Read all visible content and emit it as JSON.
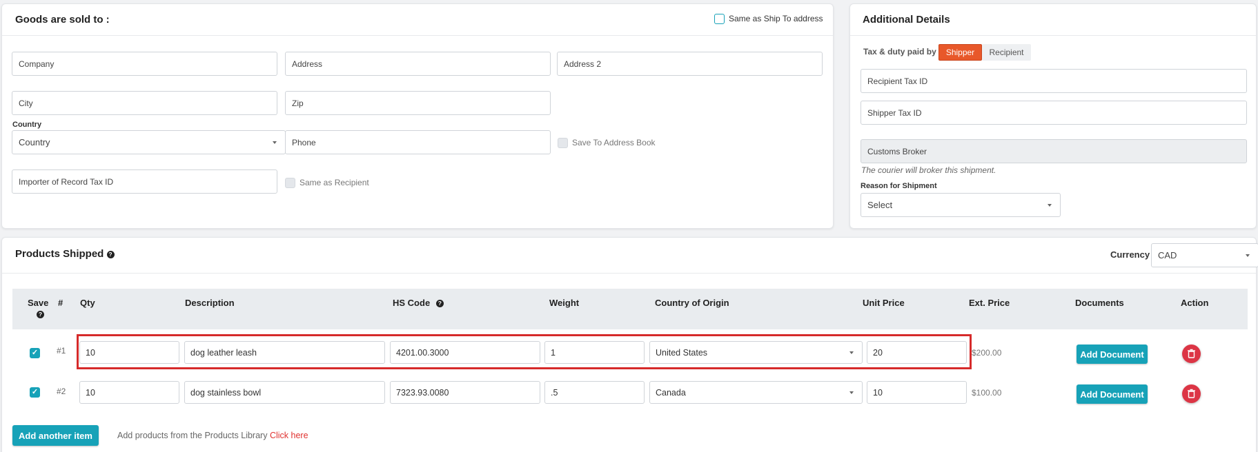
{
  "sold_to": {
    "title": "Goods are sold to :",
    "same_as_ship_to_label": "Same as Ship To address",
    "company_placeholder": "Company",
    "address_placeholder": "Address",
    "address2_placeholder": "Address 2",
    "city_placeholder": "City",
    "zip_placeholder": "Zip",
    "country_label": "Country",
    "country_value": "Country",
    "phone_placeholder": "Phone",
    "save_to_address_book_label": "Save To Address Book",
    "importer_tax_id_placeholder": "Importer of Record Tax ID",
    "same_as_recipient_label": "Same as Recipient"
  },
  "additional": {
    "title": "Additional Details",
    "tax_duty_label": "Tax & duty paid by",
    "tax_options": [
      "Shipper",
      "Recipient"
    ],
    "tax_selected": "Shipper",
    "recipient_tax_id_placeholder": "Recipient Tax ID",
    "shipper_tax_id_placeholder": "Shipper Tax ID",
    "customs_broker_placeholder": "Customs Broker",
    "broker_note": "The courier will broker this shipment.",
    "reason_label": "Reason for Shipment",
    "reason_value": "Select"
  },
  "products": {
    "title": "Products Shipped",
    "currency_label": "Currency",
    "currency_value": "CAD",
    "columns": {
      "save": "Save",
      "num": "#",
      "qty": "Qty",
      "description": "Description",
      "hs_code": "HS Code",
      "weight": "Weight",
      "country_of_origin": "Country of Origin",
      "unit_price": "Unit Price",
      "ext_price": "Ext. Price",
      "documents": "Documents",
      "action": "Action"
    },
    "rows": [
      {
        "num": "#1",
        "qty": "10",
        "description": "dog leather leash",
        "hs_code": "4201.00.3000",
        "weight": "1",
        "country": "United States",
        "unit_price": "20",
        "ext_price": "$200.00",
        "doc_button": "Add Document",
        "saved": true
      },
      {
        "num": "#2",
        "qty": "10",
        "description": "dog stainless bowl",
        "hs_code": "7323.93.0080",
        "weight": ".5",
        "country": "Canada",
        "unit_price": "10",
        "ext_price": "$100.00",
        "doc_button": "Add Document",
        "saved": true
      }
    ],
    "add_item_label": "Add another item",
    "library_text": "Add products from the Products Library",
    "library_link": "Click here"
  },
  "colors": {
    "accent_teal": "#17a2b8",
    "shipper_orange": "#e8582a",
    "danger_red": "#dc3545",
    "highlight_red": "#d62a2a",
    "link_red": "#e0312f"
  },
  "icons": {
    "help": "question-circle-icon",
    "delete": "trash-icon",
    "dropdown": "caret-down-icon",
    "check": "checkmark-icon"
  }
}
